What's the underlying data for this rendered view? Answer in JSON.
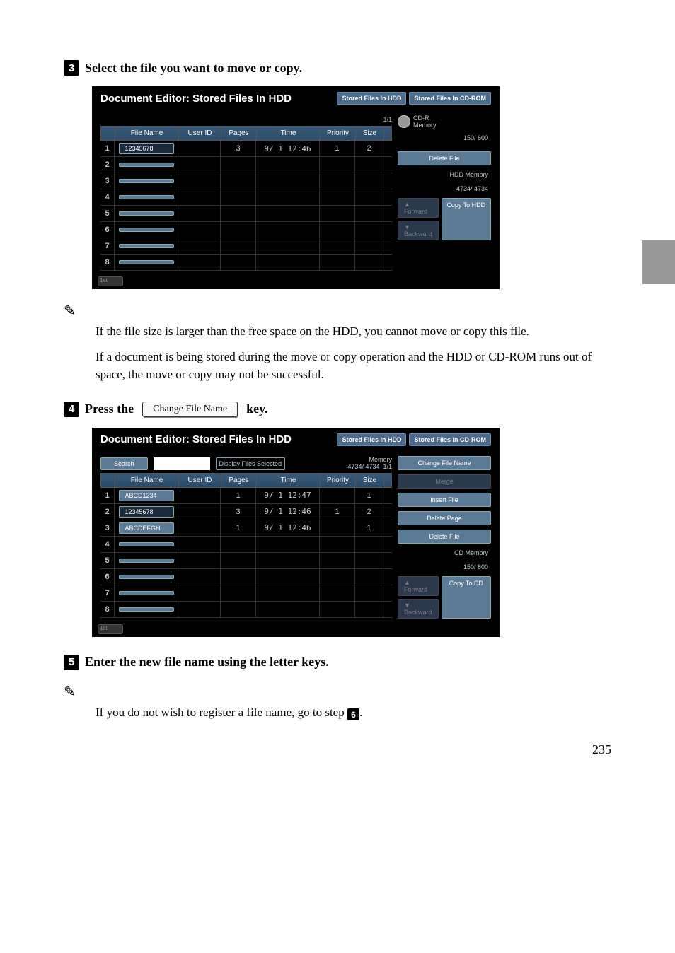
{
  "steps": {
    "s3_num": "3",
    "s3_text": "Select the file you want to move or copy.",
    "s4_num": "4",
    "s4_pre": "Press the",
    "s4_key": "Change File Name",
    "s4_post": "key.",
    "s5_num": "5",
    "s5_text": "Enter the new file name using the letter keys.",
    "ref6": "6"
  },
  "notes": {
    "a1": "If the file size is larger than the free space on the HDD, you cannot move or copy this file.",
    "a2": "If a document is being stored during the move or copy operation and the HDD or CD-ROM runs out of space, the move or copy may not be successful.",
    "b1_pre": "If you do not wish to register a file name, go to step ",
    "b1_post": "."
  },
  "shot1": {
    "title": "Document Editor: Stored Files In HDD",
    "tab1": "Stored Files In HDD",
    "tab2": "Stored Files In CD-ROM",
    "page": "1/1",
    "mem_label": "CD-R\nMemory",
    "mem_val": "150/    600",
    "cols": {
      "file": "File Name",
      "user": "User ID",
      "pages": "Pages",
      "time": "Time",
      "priority": "Priority",
      "size": "Size"
    },
    "rows": [
      {
        "n": "1",
        "file": "12345678",
        "pages": "3",
        "time": "9/ 1 12:46",
        "priority": "1",
        "size": "2",
        "hilite": true
      }
    ],
    "empty_rows": [
      "2",
      "3",
      "4",
      "5",
      "6",
      "7",
      "8"
    ],
    "btn_delete": "Delete File",
    "hdd_label": "HDD Memory",
    "hdd_val": "4734/  4734",
    "btn_fwd": "Forward",
    "btn_back": "Backward",
    "btn_copy": "Copy To HDD",
    "bulge": "1st"
  },
  "shot2": {
    "title": "Document Editor: Stored Files In HDD",
    "tab1": "Stored Files In HDD",
    "tab2": "Stored Files In CD-ROM",
    "search": "Search",
    "display_sel": "Display Files Selected",
    "mem_label": "Memory",
    "mem_val": "4734/  4734",
    "page": "1/1",
    "cols": {
      "file": "File Name",
      "user": "User ID",
      "pages": "Pages",
      "time": "Time",
      "priority": "Priority",
      "size": "Size"
    },
    "rows": [
      {
        "n": "1",
        "file": "ABCD1234",
        "pages": "1",
        "time": "9/ 1 12:47",
        "priority": "",
        "size": "1"
      },
      {
        "n": "2",
        "file": "12345678",
        "pages": "3",
        "time": "9/ 1 12:46",
        "priority": "1",
        "size": "2",
        "hilite": true
      },
      {
        "n": "3",
        "file": "ABCDEFGH",
        "pages": "1",
        "time": "9/ 1 12:46",
        "priority": "",
        "size": "1"
      }
    ],
    "empty_rows": [
      "4",
      "5",
      "6",
      "7",
      "8"
    ],
    "btn_change": "Change File Name",
    "btn_merge": "Merge",
    "btn_insert": "Insert File",
    "btn_delpage": "Delete Page",
    "btn_delfile": "Delete File",
    "cd_label": "CD Memory",
    "cd_val": "150/    600",
    "btn_fwd": "Forward",
    "btn_back": "Backward",
    "btn_copy": "Copy To CD",
    "bulge": "1st"
  },
  "page_number": "235"
}
